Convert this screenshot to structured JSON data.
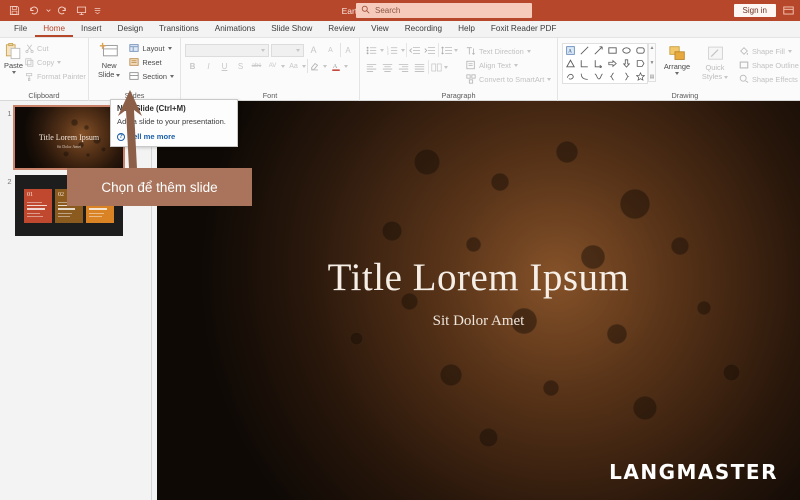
{
  "titlebar": {
    "doc_title": "Earthy inspiration  -  PowerPoint",
    "qat": [
      {
        "name": "save-icon",
        "label": "Save"
      },
      {
        "name": "undo-icon",
        "label": "Undo"
      },
      {
        "name": "redo-icon",
        "label": "Repeat"
      },
      {
        "name": "start-presentation-icon",
        "label": "Start From Beginning"
      },
      {
        "name": "customize-qat-icon",
        "label": "Customize Quick Access Toolbar"
      }
    ],
    "search": {
      "placeholder": "Search",
      "icon": "search-icon"
    },
    "signin_label": "Sign in",
    "window_button": "ribbon-display-options-icon",
    "accent_color": "#b7472a",
    "search_bg": "#f6cbbb"
  },
  "tabs": [
    {
      "label": "File",
      "active": false
    },
    {
      "label": "Home",
      "active": true
    },
    {
      "label": "Insert",
      "active": false
    },
    {
      "label": "Design",
      "active": false
    },
    {
      "label": "Transitions",
      "active": false
    },
    {
      "label": "Animations",
      "active": false
    },
    {
      "label": "Slide Show",
      "active": false
    },
    {
      "label": "Review",
      "active": false
    },
    {
      "label": "View",
      "active": false
    },
    {
      "label": "Recording",
      "active": false
    },
    {
      "label": "Help",
      "active": false
    },
    {
      "label": "Foxit Reader PDF",
      "active": false
    }
  ],
  "ribbon": {
    "clipboard": {
      "label": "Clipboard",
      "paste_label": "Paste",
      "cut_label": "Cut",
      "copy_label": "Copy",
      "format_painter_label": "Format Painter"
    },
    "slides": {
      "label": "Slides",
      "new_slide_label_line1": "New",
      "new_slide_label_line2": "Slide",
      "layout_label": "Layout",
      "reset_label": "Reset",
      "section_label": "Section"
    },
    "font": {
      "label": "Font",
      "font_name_value": "",
      "font_size_value": "",
      "increase_size": "A",
      "decrease_size": "A",
      "clear_formatting": "A",
      "bold": "B",
      "italic": "I",
      "underline": "U",
      "shadow": "S",
      "strikethrough": "abc",
      "character_spacing": "AV",
      "change_case": "Aa",
      "text_highlight": "A",
      "font_color": "A"
    },
    "paragraph": {
      "label": "Paragraph",
      "text_direction_label": "Text Direction",
      "align_text_label": "Align Text",
      "convert_smartart_label": "Convert to SmartArt"
    },
    "drawing": {
      "label": "Drawing",
      "arrange_label": "Arrange",
      "quick_styles_line1": "Quick",
      "quick_styles_line2": "Styles",
      "shape_fill_label": "Shape Fill",
      "shape_outline_label": "Shape Outline",
      "shape_effects_label": "Shape Effects"
    }
  },
  "tooltip": {
    "title": "New Slide (Ctrl+M)",
    "description": "Add a slide to your presentation.",
    "more_label": "Tell me more",
    "more_icon": "help-circle-icon"
  },
  "callout": {
    "text": "Chọn để thêm slide",
    "bg_color": "#a9745b",
    "arrow_color": "#8c6048"
  },
  "thumbnails": [
    {
      "number": "1",
      "selected": true,
      "title": "Title Lorem Ipsum",
      "subtitle": "Sit Dolor Amet"
    },
    {
      "number": "2",
      "selected": false,
      "cards": [
        {
          "num": "01",
          "color": "#c0482f"
        },
        {
          "num": "02",
          "color": "#8a5a1e"
        },
        {
          "num": "03",
          "color": "#d98324"
        }
      ]
    }
  ],
  "slide": {
    "title": "Title Lorem Ipsum",
    "subtitle": "Sit Dolor Amet",
    "watermark": "LANGMASTER"
  }
}
